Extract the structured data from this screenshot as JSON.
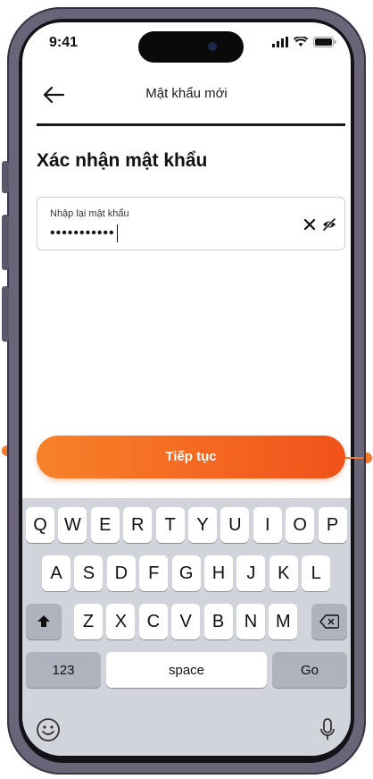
{
  "status_bar": {
    "time": "9:41"
  },
  "nav": {
    "title": "Mật khẩu mới"
  },
  "progress": {
    "fraction": 1.0
  },
  "page": {
    "heading": "Xác nhận mật khẩu"
  },
  "password_field": {
    "label": "Nhập lại mật khẩu",
    "value": "•••••••••••"
  },
  "cta": {
    "label": "Tiếp tục"
  },
  "keyboard": {
    "row1": [
      "Q",
      "W",
      "E",
      "R",
      "T",
      "Y",
      "U",
      "I",
      "O",
      "P"
    ],
    "row2": [
      "A",
      "S",
      "D",
      "F",
      "G",
      "H",
      "J",
      "K",
      "L"
    ],
    "row3": [
      "Z",
      "X",
      "C",
      "V",
      "B",
      "N",
      "M"
    ],
    "numbers_label": "123",
    "space_label": "space",
    "go_label": "Go"
  },
  "colors": {
    "accent_start": "#f7822a",
    "accent_end": "#f1521a"
  }
}
